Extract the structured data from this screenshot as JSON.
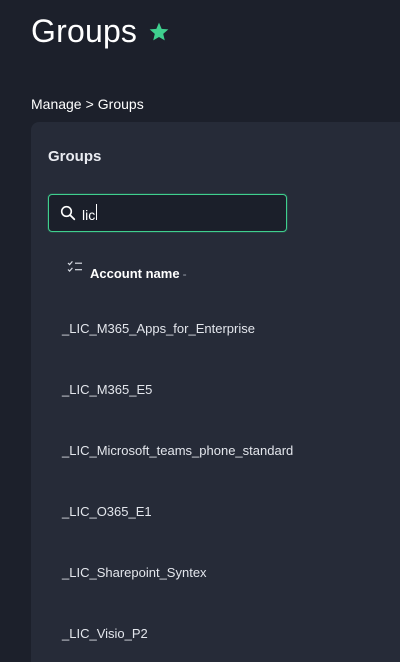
{
  "header": {
    "title": "Groups",
    "favorite_icon": "star-icon",
    "accent_color": "#3fcf8e"
  },
  "breadcrumb": {
    "parent": "Manage",
    "separator": ">",
    "current": "Groups"
  },
  "card": {
    "title": "Groups",
    "search": {
      "value": "lic",
      "icon": "search-icon"
    },
    "table": {
      "select_icon": "checklist-icon",
      "column_header": "Account name",
      "sort_indicator": "-",
      "rows": [
        "_LIC_M365_Apps_for_Enterprise",
        "_LIC_M365_E5",
        "_LIC_Microsoft_teams_phone_standard",
        "_LIC_O365_E1",
        "_LIC_Sharepoint_Syntex",
        "_LIC_Visio_P2"
      ]
    }
  }
}
